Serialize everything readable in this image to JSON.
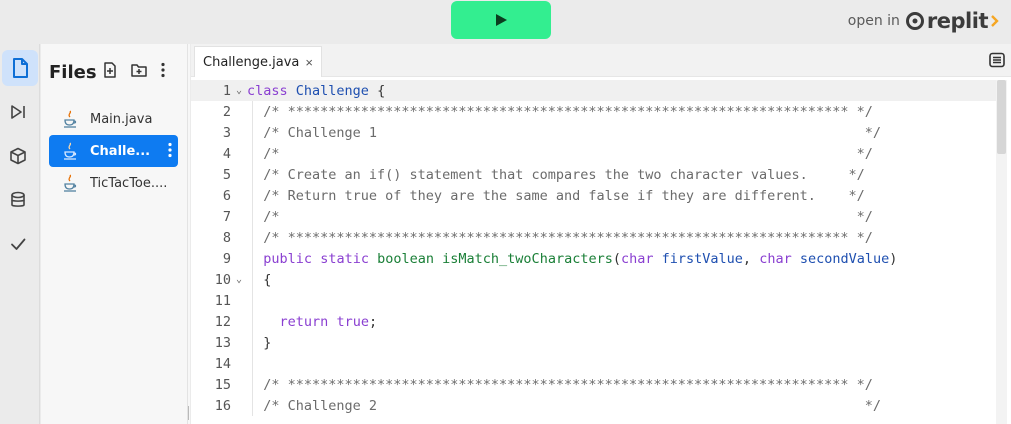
{
  "run_button": {
    "icon": "play-icon",
    "color": "#33ee90"
  },
  "open_in": {
    "label": "open in",
    "brand": "replit"
  },
  "rail": {
    "items": [
      {
        "name": "files",
        "icon": "file-icon",
        "active": true
      },
      {
        "name": "debugger",
        "icon": "step-forward-icon"
      },
      {
        "name": "packages",
        "icon": "cube-icon"
      },
      {
        "name": "database",
        "icon": "database-icon"
      },
      {
        "name": "tests",
        "icon": "check-icon"
      }
    ]
  },
  "files_panel": {
    "title": "Files",
    "items": [
      {
        "label": "Main.java",
        "icon": "java-icon"
      },
      {
        "label": "Challe...",
        "icon": "java-icon",
        "active": true
      },
      {
        "label": "TicTacToe....",
        "icon": "java-icon"
      }
    ]
  },
  "editor": {
    "tab": {
      "label": "Challenge.java",
      "close": "×"
    },
    "lines": [
      {
        "n": "1",
        "fold": "⌄"
      },
      {
        "n": "2",
        "text": "  /* ********************************************************************* */"
      },
      {
        "n": "3",
        "text": "  /* Challenge 1                                                            */"
      },
      {
        "n": "4",
        "text": "  /*                                                                       */"
      },
      {
        "n": "5",
        "text": "  /* Create an if() statement that compares the two character values.     */"
      },
      {
        "n": "6",
        "text": "  /* Return true of they are the same and false if they are different.    */"
      },
      {
        "n": "7",
        "text": "  /*                                                                       */"
      },
      {
        "n": "8",
        "text": "  /* ********************************************************************* */"
      },
      {
        "n": "9"
      },
      {
        "n": "10",
        "fold": "⌄",
        "text": "  {"
      },
      {
        "n": "11",
        "text": ""
      },
      {
        "n": "12"
      },
      {
        "n": "13",
        "text": "  }"
      },
      {
        "n": "14",
        "text": ""
      },
      {
        "n": "15",
        "text": "  /* ********************************************************************* */"
      },
      {
        "n": "16",
        "text": "  /* Challenge 2                                                            */"
      }
    ],
    "tokens": {
      "l1_kw": "class",
      "l1_cls": "Challenge",
      "l1_rest": " {",
      "l9_public": "public",
      "l9_static": "static",
      "l9_boolean": "boolean",
      "l9_fn": "isMatch_twoCharacters",
      "l9_open": "(",
      "l9_char1": "char",
      "l9_v1": "firstValue",
      "l9_comma": ", ",
      "l9_char2": "char",
      "l9_v2": "secondValue",
      "l9_close": ")",
      "l12_return": "return",
      "l12_true": "true",
      "l12_semi": ";"
    }
  }
}
